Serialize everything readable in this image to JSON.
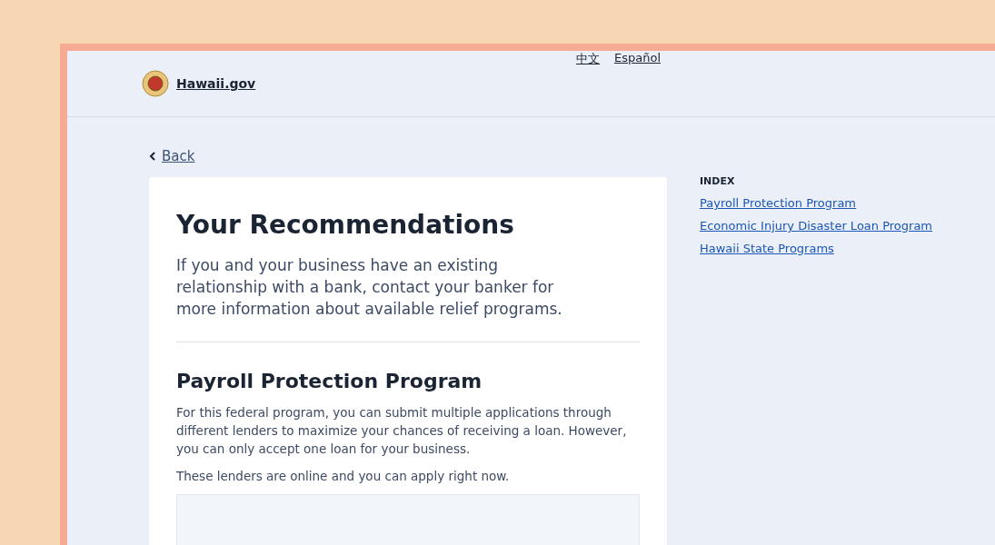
{
  "header": {
    "site": "Hawaii.gov",
    "languages": [
      "中文",
      "Español"
    ]
  },
  "back": "Back",
  "recommendations": {
    "title": "Your Recommendations",
    "intro": "If you and your business have an existing relationship with a bank, contact your banker for more information about available relief programs."
  },
  "program": {
    "title": "Payroll Protection Program",
    "paragraphs": [
      "For this federal program, you can submit multiple applications through different lenders to maximize your chances of receiving a loan. However, you can only accept one loan for your business.",
      "These lenders are online and you can apply right now."
    ]
  },
  "index": {
    "title": "INDEX",
    "links": [
      "Payroll Protection Program",
      "Economic Injury Disaster Loan Program",
      "Hawaii State Programs"
    ]
  }
}
